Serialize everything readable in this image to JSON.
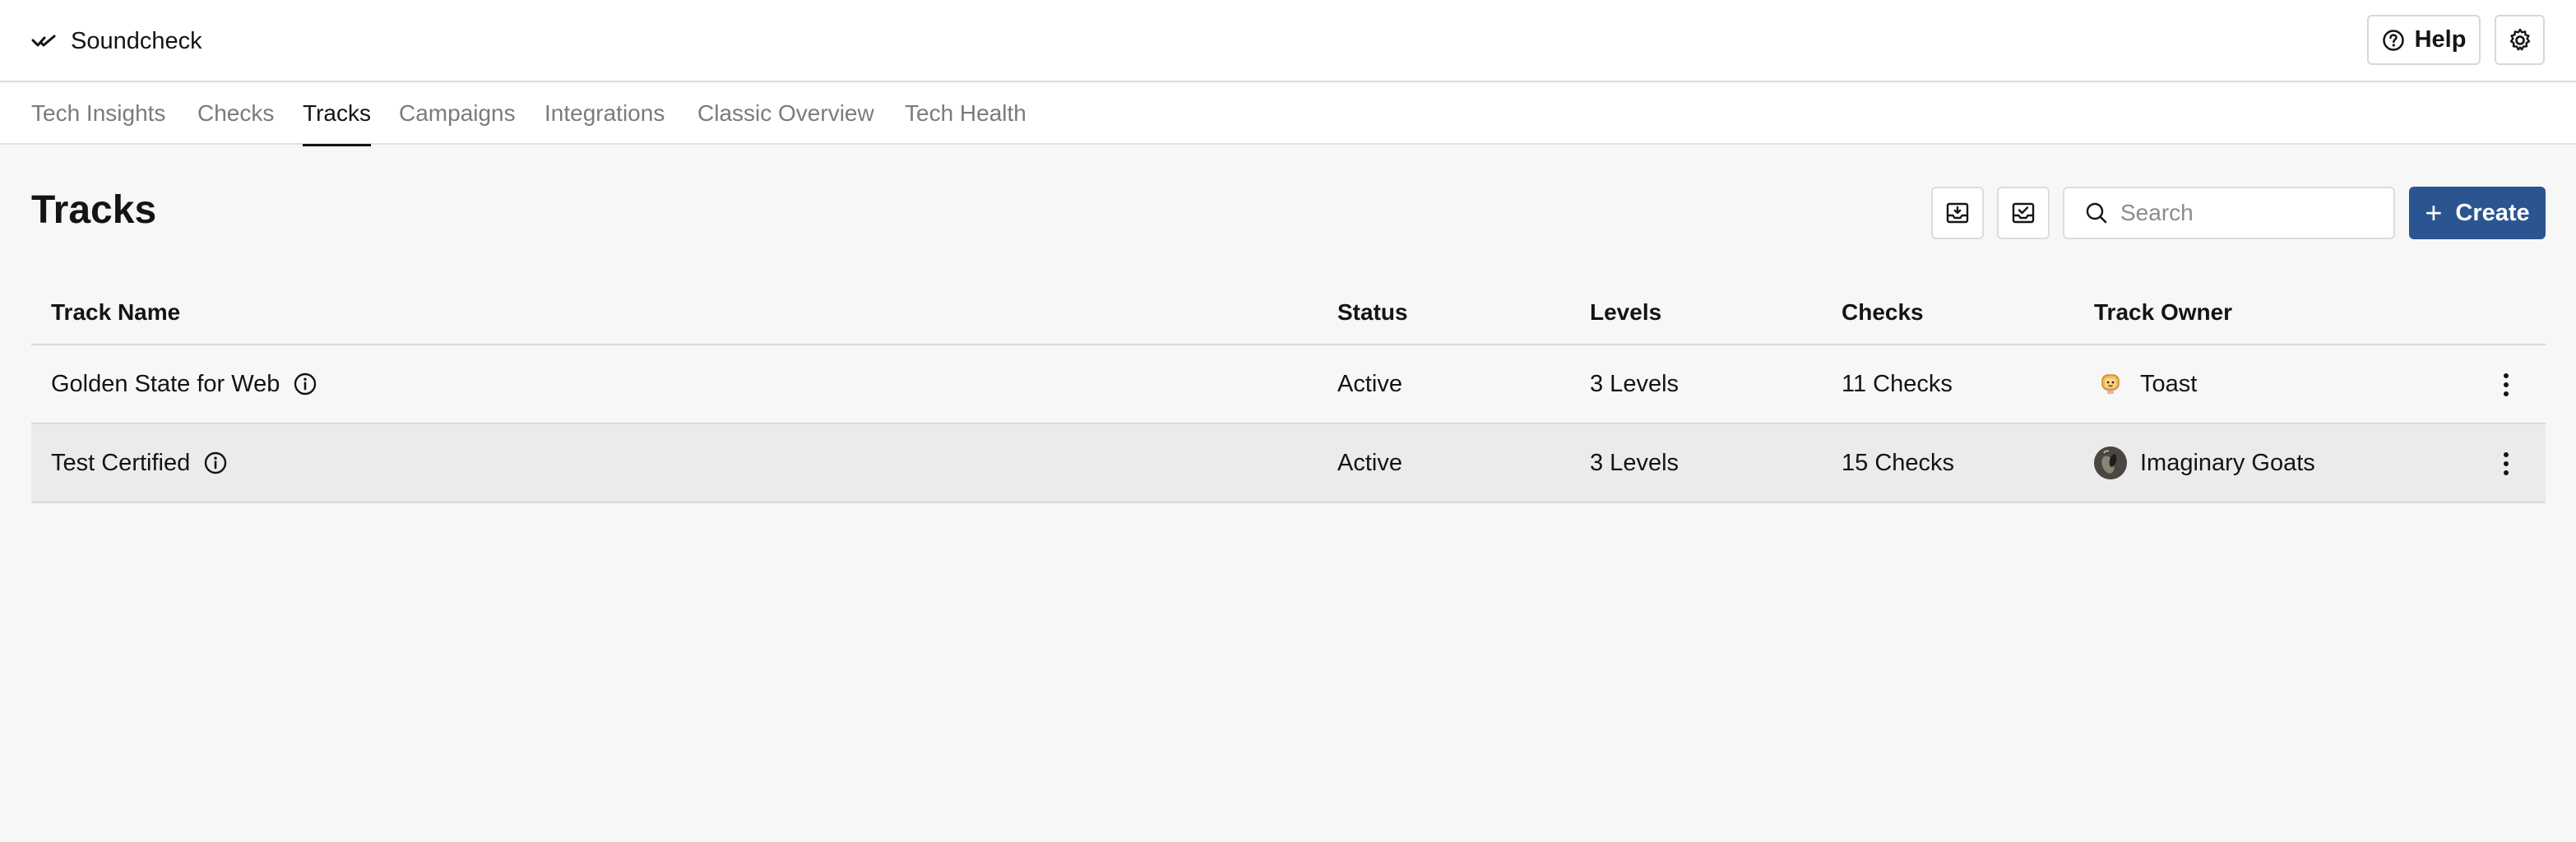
{
  "app": {
    "name": "Soundcheck"
  },
  "header": {
    "help_label": "Help"
  },
  "tabs": [
    {
      "label": "Tech Insights",
      "active": false
    },
    {
      "label": "Checks",
      "active": false
    },
    {
      "label": "Tracks",
      "active": true
    },
    {
      "label": "Campaigns",
      "active": false
    },
    {
      "label": "Integrations",
      "active": false
    },
    {
      "label": "Classic Overview",
      "active": false
    },
    {
      "label": "Tech Health",
      "active": false
    }
  ],
  "page": {
    "title": "Tracks",
    "search_placeholder": "Search",
    "create_label": "Create"
  },
  "table": {
    "columns": [
      "Track Name",
      "Status",
      "Levels",
      "Checks",
      "Track Owner"
    ],
    "rows": [
      {
        "name": "Golden State for Web",
        "status": "Active",
        "levels": "3 Levels",
        "checks": "11 Checks",
        "owner": "Toast",
        "owner_avatar": "toast-avatar"
      },
      {
        "name": "Test Certified",
        "status": "Active",
        "levels": "3 Levels",
        "checks": "15 Checks",
        "owner": "Imaginary Goats",
        "owner_avatar": "goat-avatar"
      }
    ]
  },
  "colors": {
    "primary": "#2b5591",
    "background": "#f7f7f7",
    "row_highlight": "#ebebeb",
    "tab_inactive": "#7b7b7b"
  },
  "icons": {
    "brand": "soundcheck-logo-icon",
    "help": "help-circle-icon",
    "settings": "gear-icon",
    "import": "import-icon",
    "export": "export-icon",
    "search": "search-icon",
    "info": "info-icon",
    "row_menu": "more-vertical-icon"
  }
}
